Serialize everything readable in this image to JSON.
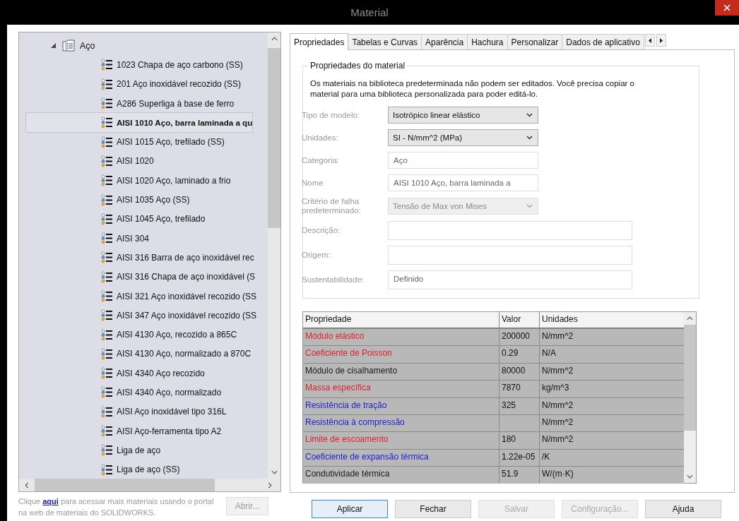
{
  "window": {
    "title": "Material"
  },
  "tree": {
    "label": "Aço",
    "expanded": true,
    "children": [
      {
        "label": "1023 Chapa de aço carbono (SS)",
        "selected": false
      },
      {
        "label": "201 Aço inoxidável recozido (SS)",
        "selected": false
      },
      {
        "label": "A286 Superliga à base de ferro",
        "selected": false
      },
      {
        "label": "AISI 1010 Aço, barra laminada a qu",
        "selected": true
      },
      {
        "label": "AISI 1015 Aço, trefilado (SS)",
        "selected": false
      },
      {
        "label": "AISI 1020",
        "selected": false
      },
      {
        "label": "AISI 1020 Aço, laminado a frio",
        "selected": false
      },
      {
        "label": "AISI 1035 Aço (SS)",
        "selected": false
      },
      {
        "label": "AISI 1045 Aço, trefilado",
        "selected": false
      },
      {
        "label": "AISI 304",
        "selected": false
      },
      {
        "label": "AISI 316 Barra de aço inoxidável rec",
        "selected": false
      },
      {
        "label": "AISI 316 Chapa de aço inoxidável (S",
        "selected": false
      },
      {
        "label": "AISI 321 Aço inoxidável recozido (SS",
        "selected": false
      },
      {
        "label": "AISI 347 Aço inoxidável recozido (SS",
        "selected": false
      },
      {
        "label": "AISI 4130 Aço, recozido a 865C",
        "selected": false
      },
      {
        "label": "AISI 4130 Aço, normalizado a 870C",
        "selected": false
      },
      {
        "label": "AISI 4340 Aço recozido",
        "selected": false
      },
      {
        "label": "AISI 4340 Aço, normalizado",
        "selected": false
      },
      {
        "label": "AISI Aço inoxidável tipo 316L",
        "selected": false
      },
      {
        "label": "AISI Aço-ferramenta tipo A2",
        "selected": false
      },
      {
        "label": "Liga de aço",
        "selected": false
      },
      {
        "label": "Liga de aço (SS)",
        "selected": false
      }
    ]
  },
  "footer": {
    "text_before": "Clique",
    "link": "aqui",
    "text_after": "para acessar mais materiais usando o portal na web de materiais do SOLIDWORKS.",
    "open_button": {
      "label": "Abrir...",
      "disabled": true
    }
  },
  "tabs": [
    {
      "label": "Propriedades",
      "selected": true
    },
    {
      "label": "Tabelas e Curvas",
      "selected": false
    },
    {
      "label": "Aparência",
      "selected": false
    },
    {
      "label": "Hachura",
      "selected": false
    },
    {
      "label": "Personalizar",
      "selected": false
    },
    {
      "label": "Dados de aplicativo",
      "selected": false
    }
  ],
  "material_properties": {
    "title": "Propriedades do material",
    "note": "Os materiais na biblioteca predeterminada não podem ser editados. Você precisa copiar o material para uma biblioteca personalizada para poder editá-lo.",
    "fields": [
      {
        "label": "Tipo de modelo:",
        "kind": "dropdown",
        "value": "Isotrópico linear elástico",
        "disabled": false
      },
      {
        "label": "Unidades:",
        "kind": "dropdown",
        "value": "SI - N/mm^2 (MPa)",
        "disabled": false
      },
      {
        "label": "Categoria:",
        "kind": "text",
        "value": "Aço"
      },
      {
        "label": "Nome",
        "kind": "text",
        "value": "AISI 1010 Aço, barra laminada a"
      },
      {
        "label": "Critério de falha predeterminado:",
        "kind": "dropdown",
        "value": "Tensão de Max von Mises",
        "disabled": true
      },
      {
        "label": "Descrição:",
        "kind": "box"
      },
      {
        "label": "Origem:",
        "kind": "box"
      },
      {
        "label": "Sustentabilidade:",
        "kind": "box",
        "value": "Definido"
      }
    ]
  },
  "table": {
    "columns": [
      "Propriedade",
      "Valor",
      "Unidades"
    ],
    "rows": [
      {
        "property": "Módulo elástico",
        "color": "#e0202a",
        "value": "200000",
        "units": "N/mm^2"
      },
      {
        "property": "Coeficiente de Poisson",
        "color": "#e0202a",
        "value": "0.29",
        "units": "N/A"
      },
      {
        "property": "Módulo de cisalhamento",
        "color": "#1a1a1a",
        "value": "80000",
        "units": "N/mm^2"
      },
      {
        "property": "Massa específica",
        "color": "#e0202a",
        "value": "7870",
        "units": "kg/m^3"
      },
      {
        "property": "Resistência de tração",
        "color": "#2020d0",
        "value": "325",
        "units": "N/mm^2"
      },
      {
        "property": "Resistência à compressão",
        "color": "#2020d0",
        "units": "N/mm^2"
      },
      {
        "property": "Limite de escoamento",
        "color": "#e0202a",
        "value": "180",
        "units": "N/mm^2"
      },
      {
        "property": "Coeficiente de expansão térmica",
        "color": "#2020d0",
        "value": "1.22e-05",
        "units": "/K"
      },
      {
        "property": "Condutividade térmica",
        "color": "#1a1a1a",
        "value": "51.9",
        "units": "W/(m·K)"
      }
    ]
  },
  "buttons": [
    {
      "label": "Aplicar",
      "disabled": false,
      "default": true
    },
    {
      "label": "Fechar",
      "disabled": false,
      "default": false
    },
    {
      "label": "Salvar",
      "disabled": true,
      "default": false
    },
    {
      "label": "Configuração...",
      "disabled": true,
      "default": false
    },
    {
      "label": "Ajuda",
      "disabled": false,
      "default": false
    }
  ]
}
